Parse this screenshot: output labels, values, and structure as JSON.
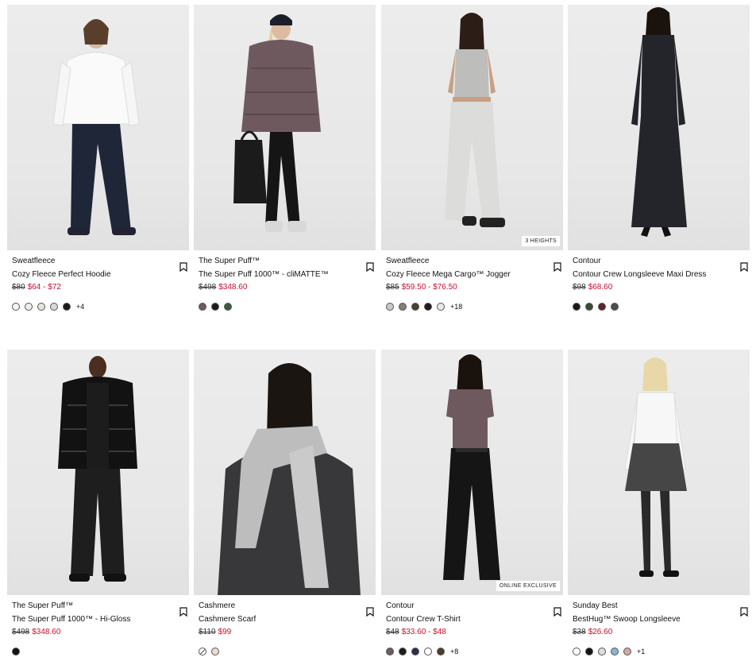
{
  "products": [
    {
      "brand": "Sweatfleece",
      "name": "Cozy Fleece Perfect Hoodie",
      "was": "$80",
      "now": "$64 - $72",
      "tag": "",
      "swatches": [
        "#f4f4f2",
        "#efefec",
        "#e7e4dc",
        "#d8d8d4",
        "#1b1b1b"
      ],
      "more": "+4"
    },
    {
      "brand": "The Super Puff™",
      "name": "The Super Puff 1000™ - cliMATTE™",
      "was": "$498",
      "now": "$348.60",
      "tag": "",
      "swatches": [
        "#6e5a5e",
        "#1c1c1c",
        "#3d5a3a"
      ],
      "more": ""
    },
    {
      "brand": "Sweatfleece",
      "name": "Cozy Fleece Mega Cargo™ Jogger",
      "was": "$85",
      "now": "$59.50 - $76.50",
      "tag": "3 HEIGHTS",
      "swatches": [
        "#c9c9c6",
        "#8a7d74",
        "#4a3f33",
        "#1c1c1c",
        "#e9e9e6"
      ],
      "more": "+18"
    },
    {
      "brand": "Contour",
      "name": "Contour Crew Longsleeve Maxi Dress",
      "was": "$98",
      "now": "$68.60",
      "tag": "",
      "swatches": [
        "#1a1a1a",
        "#3d4a32",
        "#5a2626",
        "#4c4c4a"
      ],
      "more": ""
    },
    {
      "brand": "The Super Puff™",
      "name": "The Super Puff 1000™ - Hi-Gloss",
      "was": "$498",
      "now": "$348.60",
      "tag": "",
      "swatches": [
        "#141414"
      ],
      "more": ""
    },
    {
      "brand": "Cashmere",
      "name": "Cashmere Scarf",
      "was": "$110",
      "now": "$99",
      "tag": "",
      "swatches": [
        "none",
        "#e8dccb"
      ],
      "more": ""
    },
    {
      "brand": "Contour",
      "name": "Contour Crew T-Shirt",
      "was": "$48",
      "now": "$33.60 - $48",
      "tag": "ONLINE EXCLUSIVE",
      "swatches": [
        "#6e5a5e",
        "#1c1c1c",
        "#263242",
        "#ffffff",
        "#4a3e2c"
      ],
      "more": "+8"
    },
    {
      "brand": "Sunday Best",
      "name": "BestHug™ Swoop Longsleeve",
      "was": "$38",
      "now": "$26.60",
      "tag": "",
      "swatches": [
        "#ffffff",
        "#141414",
        "#dcdcd8",
        "#8fb0d4",
        "#d4a8a4"
      ],
      "more": "+1"
    }
  ]
}
